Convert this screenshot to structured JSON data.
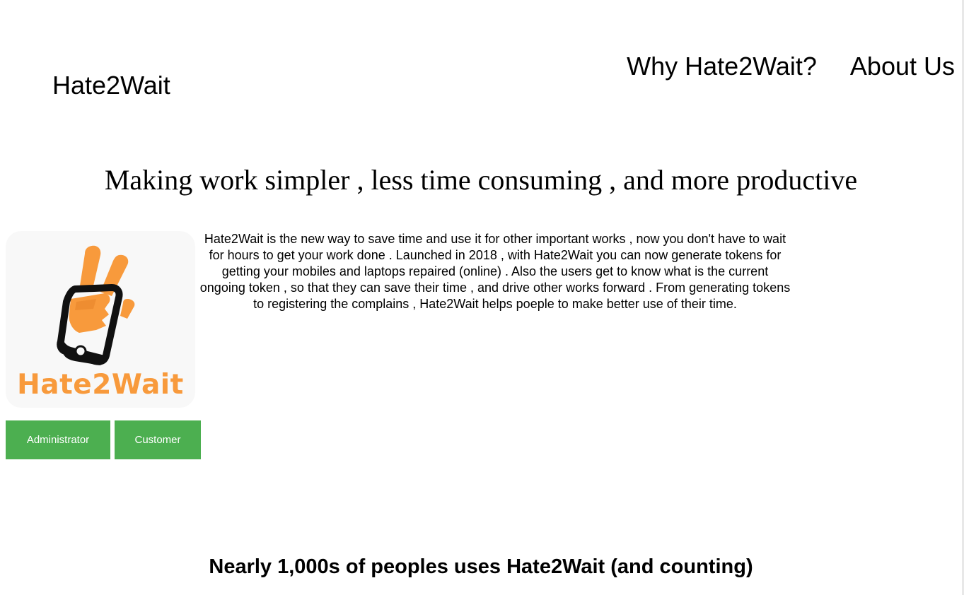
{
  "header": {
    "brand": "Hate2Wait",
    "nav": [
      {
        "label": "Why Hate2Wait?"
      },
      {
        "label": "About Us"
      }
    ]
  },
  "hero": {
    "tagline": "Making work simpler , less time consuming , and more productive"
  },
  "logo": {
    "wordmark": "Hate2Wait",
    "icon": "peace-hand-phone-icon",
    "colors": {
      "orange": "#f89a3c",
      "black": "#111111",
      "background": "#f8f8f8"
    }
  },
  "intro": {
    "text": "Hate2Wait is the new way to save time and use it for other important works , now you don't have to wait for hours to get your work done . Launched in 2018 , with Hate2Wait you can now generate tokens for getting your mobiles and laptops repaired (online) . Also the users get to know what is the current ongoing token , so that they can save their time , and drive other works forward . From generating tokens to registering the complains , Hate2Wait helps poeple to make better use of their time."
  },
  "actions": {
    "administrator_label": "Administrator",
    "customer_label": "Customer",
    "button_color": "#4caf50"
  },
  "stats": {
    "counter_text": "Nearly 1,000s of peoples uses Hate2Wait (and counting)"
  }
}
